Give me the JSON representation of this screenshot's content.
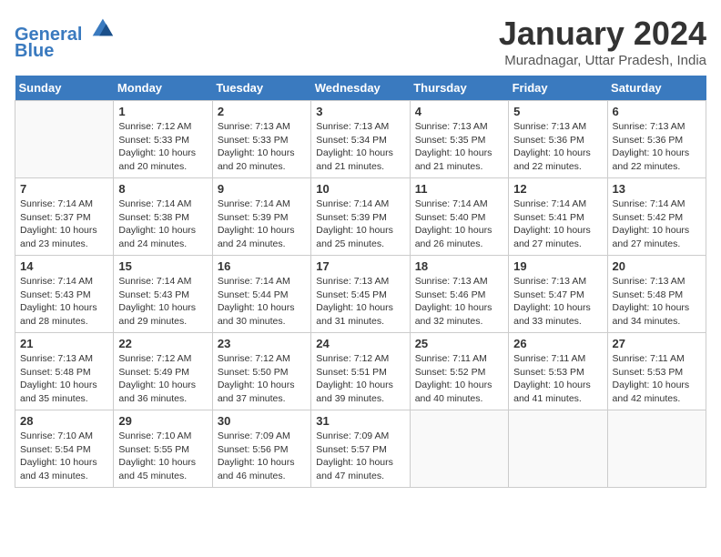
{
  "header": {
    "logo_line1": "General",
    "logo_line2": "Blue",
    "month": "January 2024",
    "location": "Muradnagar, Uttar Pradesh, India"
  },
  "weekdays": [
    "Sunday",
    "Monday",
    "Tuesday",
    "Wednesday",
    "Thursday",
    "Friday",
    "Saturday"
  ],
  "weeks": [
    [
      {
        "day": "",
        "info": ""
      },
      {
        "day": "1",
        "info": "Sunrise: 7:12 AM\nSunset: 5:33 PM\nDaylight: 10 hours\nand 20 minutes."
      },
      {
        "day": "2",
        "info": "Sunrise: 7:13 AM\nSunset: 5:33 PM\nDaylight: 10 hours\nand 20 minutes."
      },
      {
        "day": "3",
        "info": "Sunrise: 7:13 AM\nSunset: 5:34 PM\nDaylight: 10 hours\nand 21 minutes."
      },
      {
        "day": "4",
        "info": "Sunrise: 7:13 AM\nSunset: 5:35 PM\nDaylight: 10 hours\nand 21 minutes."
      },
      {
        "day": "5",
        "info": "Sunrise: 7:13 AM\nSunset: 5:36 PM\nDaylight: 10 hours\nand 22 minutes."
      },
      {
        "day": "6",
        "info": "Sunrise: 7:13 AM\nSunset: 5:36 PM\nDaylight: 10 hours\nand 22 minutes."
      }
    ],
    [
      {
        "day": "7",
        "info": "Sunrise: 7:14 AM\nSunset: 5:37 PM\nDaylight: 10 hours\nand 23 minutes."
      },
      {
        "day": "8",
        "info": "Sunrise: 7:14 AM\nSunset: 5:38 PM\nDaylight: 10 hours\nand 24 minutes."
      },
      {
        "day": "9",
        "info": "Sunrise: 7:14 AM\nSunset: 5:39 PM\nDaylight: 10 hours\nand 24 minutes."
      },
      {
        "day": "10",
        "info": "Sunrise: 7:14 AM\nSunset: 5:39 PM\nDaylight: 10 hours\nand 25 minutes."
      },
      {
        "day": "11",
        "info": "Sunrise: 7:14 AM\nSunset: 5:40 PM\nDaylight: 10 hours\nand 26 minutes."
      },
      {
        "day": "12",
        "info": "Sunrise: 7:14 AM\nSunset: 5:41 PM\nDaylight: 10 hours\nand 27 minutes."
      },
      {
        "day": "13",
        "info": "Sunrise: 7:14 AM\nSunset: 5:42 PM\nDaylight: 10 hours\nand 27 minutes."
      }
    ],
    [
      {
        "day": "14",
        "info": "Sunrise: 7:14 AM\nSunset: 5:43 PM\nDaylight: 10 hours\nand 28 minutes."
      },
      {
        "day": "15",
        "info": "Sunrise: 7:14 AM\nSunset: 5:43 PM\nDaylight: 10 hours\nand 29 minutes."
      },
      {
        "day": "16",
        "info": "Sunrise: 7:14 AM\nSunset: 5:44 PM\nDaylight: 10 hours\nand 30 minutes."
      },
      {
        "day": "17",
        "info": "Sunrise: 7:13 AM\nSunset: 5:45 PM\nDaylight: 10 hours\nand 31 minutes."
      },
      {
        "day": "18",
        "info": "Sunrise: 7:13 AM\nSunset: 5:46 PM\nDaylight: 10 hours\nand 32 minutes."
      },
      {
        "day": "19",
        "info": "Sunrise: 7:13 AM\nSunset: 5:47 PM\nDaylight: 10 hours\nand 33 minutes."
      },
      {
        "day": "20",
        "info": "Sunrise: 7:13 AM\nSunset: 5:48 PM\nDaylight: 10 hours\nand 34 minutes."
      }
    ],
    [
      {
        "day": "21",
        "info": "Sunrise: 7:13 AM\nSunset: 5:48 PM\nDaylight: 10 hours\nand 35 minutes."
      },
      {
        "day": "22",
        "info": "Sunrise: 7:12 AM\nSunset: 5:49 PM\nDaylight: 10 hours\nand 36 minutes."
      },
      {
        "day": "23",
        "info": "Sunrise: 7:12 AM\nSunset: 5:50 PM\nDaylight: 10 hours\nand 37 minutes."
      },
      {
        "day": "24",
        "info": "Sunrise: 7:12 AM\nSunset: 5:51 PM\nDaylight: 10 hours\nand 39 minutes."
      },
      {
        "day": "25",
        "info": "Sunrise: 7:11 AM\nSunset: 5:52 PM\nDaylight: 10 hours\nand 40 minutes."
      },
      {
        "day": "26",
        "info": "Sunrise: 7:11 AM\nSunset: 5:53 PM\nDaylight: 10 hours\nand 41 minutes."
      },
      {
        "day": "27",
        "info": "Sunrise: 7:11 AM\nSunset: 5:53 PM\nDaylight: 10 hours\nand 42 minutes."
      }
    ],
    [
      {
        "day": "28",
        "info": "Sunrise: 7:10 AM\nSunset: 5:54 PM\nDaylight: 10 hours\nand 43 minutes."
      },
      {
        "day": "29",
        "info": "Sunrise: 7:10 AM\nSunset: 5:55 PM\nDaylight: 10 hours\nand 45 minutes."
      },
      {
        "day": "30",
        "info": "Sunrise: 7:09 AM\nSunset: 5:56 PM\nDaylight: 10 hours\nand 46 minutes."
      },
      {
        "day": "31",
        "info": "Sunrise: 7:09 AM\nSunset: 5:57 PM\nDaylight: 10 hours\nand 47 minutes."
      },
      {
        "day": "",
        "info": ""
      },
      {
        "day": "",
        "info": ""
      },
      {
        "day": "",
        "info": ""
      }
    ]
  ]
}
